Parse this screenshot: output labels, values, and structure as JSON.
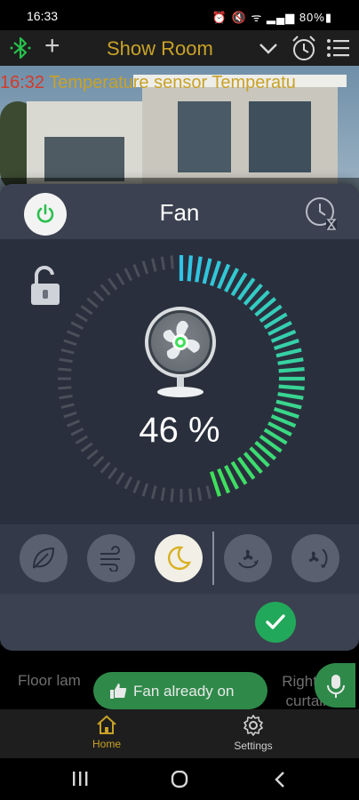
{
  "status_bar": {
    "time": "16:33",
    "icons_text": "⏰ 🔇 ᯤ ▂▄▆ 80%▮",
    "battery": "80%"
  },
  "header": {
    "title": "Show Room",
    "bluetooth_icon": "bluetooth-icon",
    "add_icon": "plus-icon",
    "plus_label": "+",
    "alarm_icon": "alarm-clock-icon",
    "menu_icon": "list-menu-icon"
  },
  "marquee": {
    "time": "16:32",
    "text": "Temperature sensor Temperatu"
  },
  "fan_panel": {
    "title": "Fan",
    "percent_text": "46 %",
    "level": 0.46,
    "locked": false,
    "modes": [
      {
        "name": "eco",
        "icon": "leaf-icon",
        "active": false
      },
      {
        "name": "breeze",
        "icon": "wind-icon",
        "active": false
      },
      {
        "name": "sleep",
        "icon": "moon-icon",
        "active": true
      },
      {
        "name": "swing-vertical",
        "icon": "fan-swing-down-icon",
        "active": false
      },
      {
        "name": "swing-horizontal",
        "icon": "fan-swing-side-icon",
        "active": false
      }
    ]
  },
  "background_labels": {
    "left": "Floor lam",
    "right_line1": "Right ro",
    "right_line2": "curtain"
  },
  "toast": {
    "text": "Fan already on",
    "icon": "thumbs-up-icon"
  },
  "bottom_nav": [
    {
      "label": "Home",
      "icon": "home-icon",
      "active": true
    },
    {
      "label": "Settings",
      "icon": "gear-icon",
      "active": false
    }
  ],
  "colors": {
    "accent": "#c9a227",
    "green": "#22a85a",
    "arc_start": "#2fc4e8",
    "arc_end": "#3ee05a",
    "panel": "#2a2f3d"
  }
}
